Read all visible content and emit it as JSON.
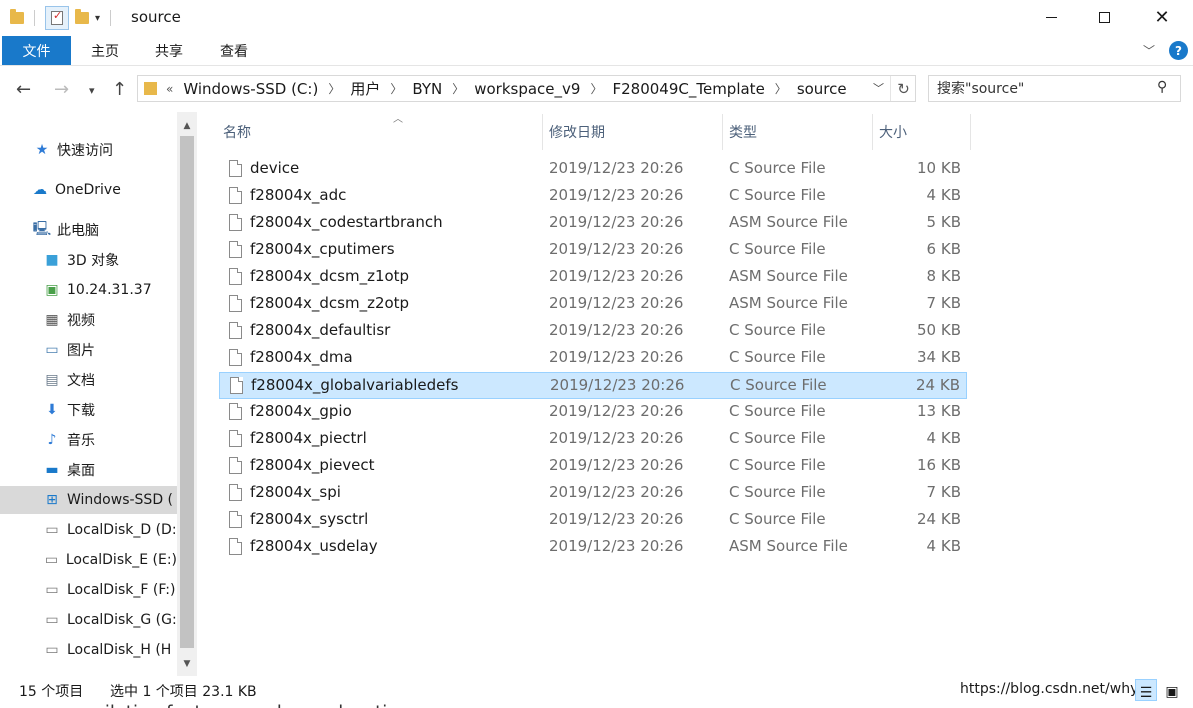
{
  "window": {
    "title": "source"
  },
  "ribbon": {
    "tabs": [
      "文件",
      "主页",
      "共享",
      "查看"
    ],
    "help_label": "?"
  },
  "address": {
    "overflow": "«",
    "crumbs": [
      "Windows-SSD (C:)",
      "用户",
      "BYN",
      "workspace_v9",
      "F280049C_Template",
      "source"
    ]
  },
  "search": {
    "placeholder": "搜索\"source\""
  },
  "nav": {
    "items": [
      {
        "label": "快速访问",
        "icon": "star-icon"
      },
      {
        "label": "OneDrive",
        "icon": "cloud-icon"
      },
      {
        "label": "此电脑",
        "icon": "computer-icon"
      },
      {
        "label": "3D 对象",
        "icon": "cube-icon"
      },
      {
        "label": "10.24.31.37",
        "icon": "network-drive-icon"
      },
      {
        "label": "视频",
        "icon": "film-icon"
      },
      {
        "label": "图片",
        "icon": "picture-icon"
      },
      {
        "label": "文档",
        "icon": "document-icon"
      },
      {
        "label": "下载",
        "icon": "download-arrow-icon"
      },
      {
        "label": "音乐",
        "icon": "music-note-icon"
      },
      {
        "label": "桌面",
        "icon": "desktop-icon"
      },
      {
        "label": "Windows-SSD (",
        "icon": "windows-drive-icon"
      },
      {
        "label": "LocalDisk_D (D:",
        "icon": "disk-drive-icon"
      },
      {
        "label": "LocalDisk_E (E:)",
        "icon": "disk-drive-icon"
      },
      {
        "label": "LocalDisk_F (F:)",
        "icon": "disk-drive-icon"
      },
      {
        "label": "LocalDisk_G (G:",
        "icon": "disk-drive-icon"
      },
      {
        "label": "LocalDisk_H (H",
        "icon": "disk-drive-icon"
      }
    ],
    "selected": "Windows-SSD ("
  },
  "columns": {
    "name": "名称",
    "date": "修改日期",
    "type": "类型",
    "size": "大小"
  },
  "files": [
    {
      "name": "device",
      "date": "2019/12/23 20:26",
      "type": "C Source File",
      "size": "10 KB"
    },
    {
      "name": "f28004x_adc",
      "date": "2019/12/23 20:26",
      "type": "C Source File",
      "size": "4 KB"
    },
    {
      "name": "f28004x_codestartbranch",
      "date": "2019/12/23 20:26",
      "type": "ASM Source File",
      "size": "5 KB"
    },
    {
      "name": "f28004x_cputimers",
      "date": "2019/12/23 20:26",
      "type": "C Source File",
      "size": "6 KB"
    },
    {
      "name": "f28004x_dcsm_z1otp",
      "date": "2019/12/23 20:26",
      "type": "ASM Source File",
      "size": "8 KB"
    },
    {
      "name": "f28004x_dcsm_z2otp",
      "date": "2019/12/23 20:26",
      "type": "ASM Source File",
      "size": "7 KB"
    },
    {
      "name": "f28004x_defaultisr",
      "date": "2019/12/23 20:26",
      "type": "C Source File",
      "size": "50 KB"
    },
    {
      "name": "f28004x_dma",
      "date": "2019/12/23 20:26",
      "type": "C Source File",
      "size": "34 KB"
    },
    {
      "name": "f28004x_globalvariabledefs",
      "date": "2019/12/23 20:26",
      "type": "C Source File",
      "size": "24 KB"
    },
    {
      "name": "f28004x_gpio",
      "date": "2019/12/23 20:26",
      "type": "C Source File",
      "size": "13 KB"
    },
    {
      "name": "f28004x_piectrl",
      "date": "2019/12/23 20:26",
      "type": "C Source File",
      "size": "4 KB"
    },
    {
      "name": "f28004x_pievect",
      "date": "2019/12/23 20:26",
      "type": "C Source File",
      "size": "16 KB"
    },
    {
      "name": "f28004x_spi",
      "date": "2019/12/23 20:26",
      "type": "C Source File",
      "size": "7 KB"
    },
    {
      "name": "f28004x_sysctrl",
      "date": "2019/12/23 20:26",
      "type": "C Source File",
      "size": "24 KB"
    },
    {
      "name": "f28004x_usdelay",
      "date": "2019/12/23 20:26",
      "type": "ASM Source File",
      "size": "4 KB"
    }
  ],
  "selected_file": "f28004x_globalvariabledefs",
  "status": {
    "count": "15 个项目",
    "selection": "选中 1 个项目  23.1 KB"
  },
  "watermark": "https://blog.csdn.net/why",
  "background_text": "compilation features such as relocation."
}
